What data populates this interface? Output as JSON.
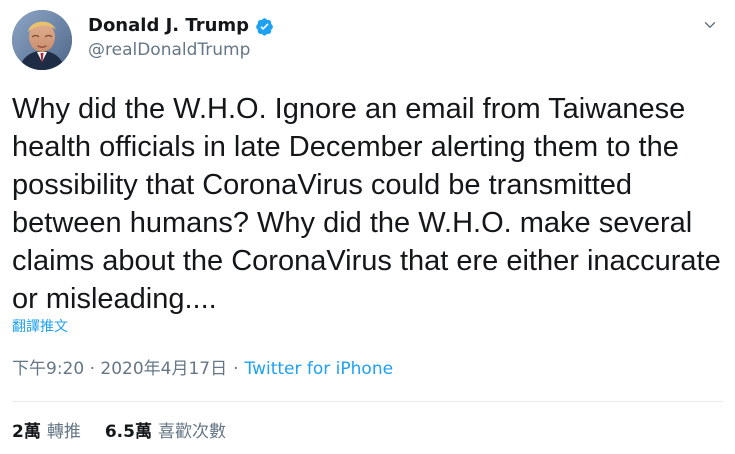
{
  "tweet": {
    "author": {
      "display_name": "Donald J. Trump",
      "handle": "@realDonaldTrump",
      "verified": true,
      "avatar_icon": "profile-photo",
      "verified_icon": "verified-badge-icon",
      "more_icon": "chevron-down-icon"
    },
    "text": "Why did the W.H.O. Ignore an email from Taiwanese health officials in late December alerting them to the possibility that CoronaVirus could be transmitted between humans? Why did the W.H.O. make several claims about the CoronaVirus that ere either inaccurate or misleading....",
    "translate_label": "翻譯推文",
    "timestamp": "下午9:20 · 2020年4月17日",
    "separator": "·",
    "source": "Twitter for iPhone",
    "stats": {
      "retweets_value": "2萬",
      "retweets_label": "轉推",
      "likes_value": "6.5萬",
      "likes_label": "喜歡次數"
    },
    "colors": {
      "accent": "#1da1f2",
      "text": "#14171a",
      "muted": "#657786",
      "divider": "#e6ecf0"
    }
  }
}
